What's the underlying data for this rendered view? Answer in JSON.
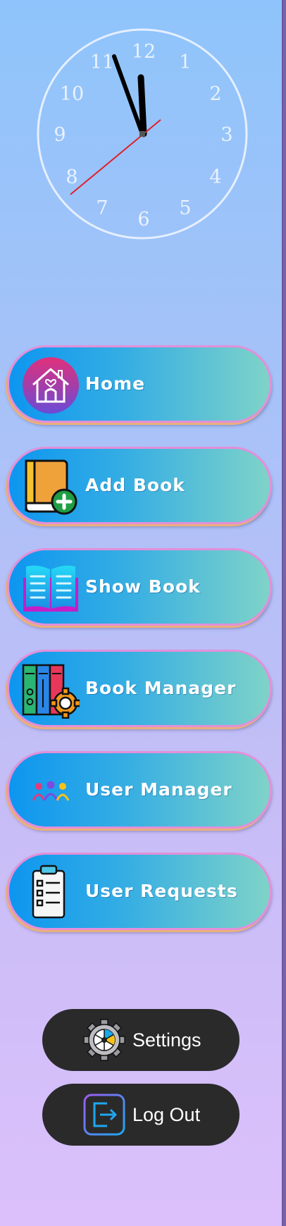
{
  "clock": {
    "numbers": [
      "12",
      "1",
      "2",
      "3",
      "4",
      "5",
      "6",
      "7",
      "8",
      "9",
      "10",
      "11"
    ]
  },
  "nav": {
    "home_label": "Home",
    "add_book_label": "Add Book",
    "show_book_label": "Show Book",
    "book_manager_label": "Book Manager",
    "user_manager_label": "User Manager",
    "user_requests_label": "User Requests"
  },
  "footer": {
    "settings_label": "Settings",
    "logout_label": "Log Out"
  },
  "icons": {
    "home": "house-icon",
    "add_book": "add-book-icon",
    "show_book": "open-book-icon",
    "book_manager": "books-gear-icon",
    "user_manager": "users-group-icon",
    "user_requests": "clipboard-icon",
    "settings": "gear-icon",
    "logout": "logout-icon"
  },
  "colors": {
    "nav_gradient_start": "#0d96f0",
    "nav_gradient_end": "#7fd3c8",
    "nav_border": "#e38fd9",
    "dark_button": "#2a2a2b",
    "clock_second_hand": "#e0202a"
  }
}
